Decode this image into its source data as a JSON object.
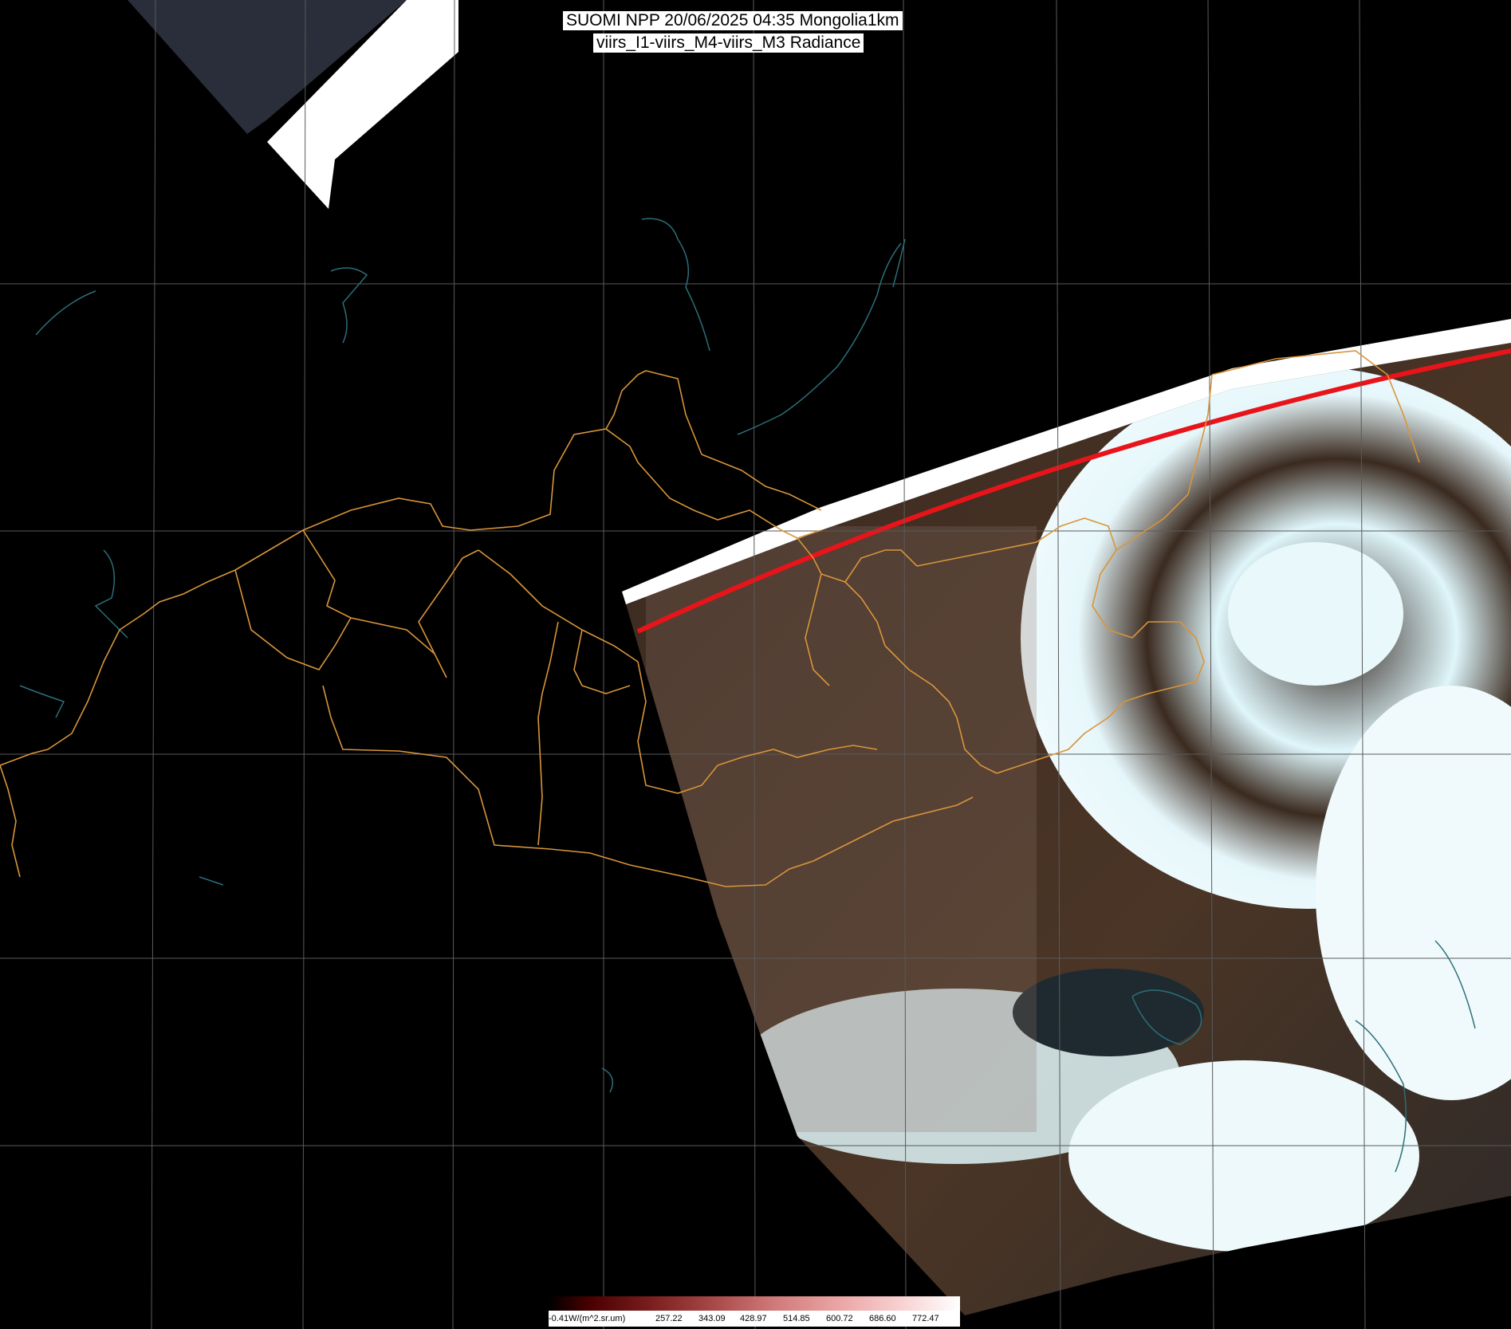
{
  "title": {
    "line1": "SUOMI NPP 20/06/2025 04:35 Mongolia1km",
    "line2": "viirs_I1-viirs_M4-viirs_M3 Radiance"
  },
  "colorbar": {
    "min_label": "-0.41W/(m^2.sr.um)",
    "ticks": [
      "257.22",
      "343.09",
      "428.97",
      "514.85",
      "600.72",
      "686.60",
      "772.47"
    ],
    "colors": [
      "#000000",
      "#4a0000",
      "#7a1e1e",
      "#a84848",
      "#d07a7a",
      "#eaa3a3",
      "#f7cfcf",
      "#ffffff"
    ]
  },
  "map": {
    "background": "#000000",
    "graticule_color": "#5a5a5a",
    "border_color": "#d8953a",
    "coast_color": "#2c6f78",
    "swath_edge_color": "#e8141a",
    "cloud_color": "#dff6fb",
    "land_color": "#4a3526"
  }
}
